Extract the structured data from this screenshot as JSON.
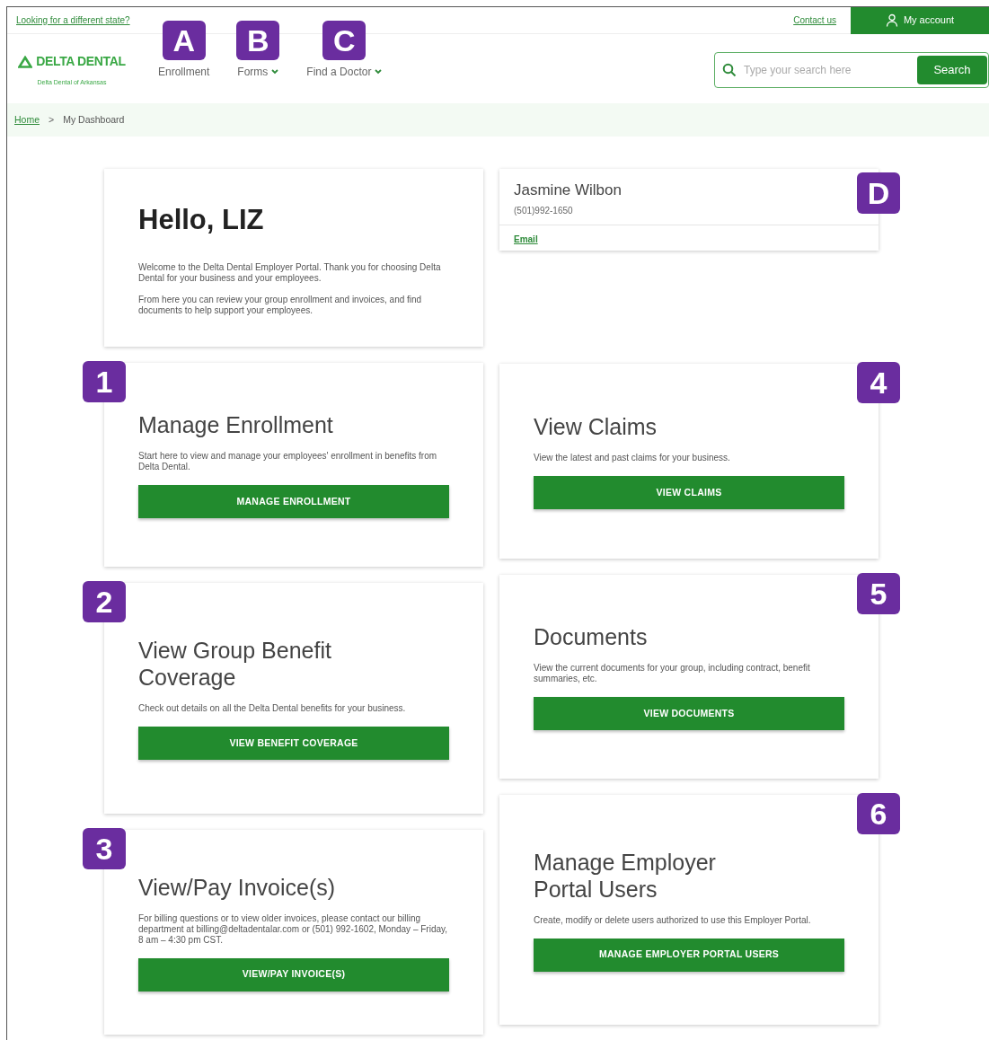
{
  "top_bar": {
    "state_link": "Looking for a different state?",
    "contact_link": "Contact us",
    "account_button": "My account"
  },
  "header": {
    "logo_text": "DELTA DENTAL",
    "logo_subtitle": "Delta Dental of Arkansas",
    "nav": [
      {
        "label": "Enrollment",
        "badge": "A",
        "dropdown": false
      },
      {
        "label": "Forms",
        "badge": "B",
        "dropdown": true
      },
      {
        "label": "Find a Doctor",
        "badge": "C",
        "dropdown": true
      }
    ],
    "search": {
      "placeholder": "Type your search here",
      "button": "Search"
    }
  },
  "breadcrumb": {
    "home": "Home",
    "separator": ">",
    "current": "My Dashboard"
  },
  "welcome": {
    "title": "Hello, LIZ",
    "paragraphs": [
      "Welcome to the Delta Dental Employer Portal. Thank you for choosing Delta Dental for your business and your employees.",
      "From here you can review your group enrollment and invoices, and find documents to help support your employees."
    ]
  },
  "contact_card": {
    "badge": "D",
    "name": "Jasmine Wilbon",
    "phone": "(501)992-1650",
    "email_link": "Email"
  },
  "left_cards": [
    {
      "badge": "1",
      "title": "Manage Enrollment",
      "text": "Start here to view and manage your employees' enrollment in benefits from Delta Dental.",
      "button": "MANAGE ENROLLMENT"
    },
    {
      "badge": "2",
      "title": "View Group Benefit Coverage",
      "text": "Check out details on all the Delta Dental benefits for your business.",
      "button": "VIEW BENEFIT COVERAGE"
    },
    {
      "badge": "3",
      "title": "View/Pay Invoice(s)",
      "text": "For billing questions or to view older invoices, please contact our billing department at billing@deltadentalar.com or (501) 992-1602, Monday – Friday, 8 am – 4:30 pm CST.",
      "button": "VIEW/PAY INVOICE(S)"
    }
  ],
  "right_cards": [
    {
      "badge": "4",
      "title": "View Claims",
      "text": "View the latest and past claims for your business.",
      "button": "VIEW CLAIMS"
    },
    {
      "badge": "5",
      "title": "Documents",
      "text": "View the current documents for your group, including contract, benefit summaries, etc.",
      "button": "VIEW DOCUMENTS"
    },
    {
      "badge": "6",
      "title": "Manage Employer Portal Users",
      "text": "Create, modify or delete users authorized to use this Employer Portal.",
      "button": "MANAGE EMPLOYER PORTAL USERS"
    }
  ]
}
